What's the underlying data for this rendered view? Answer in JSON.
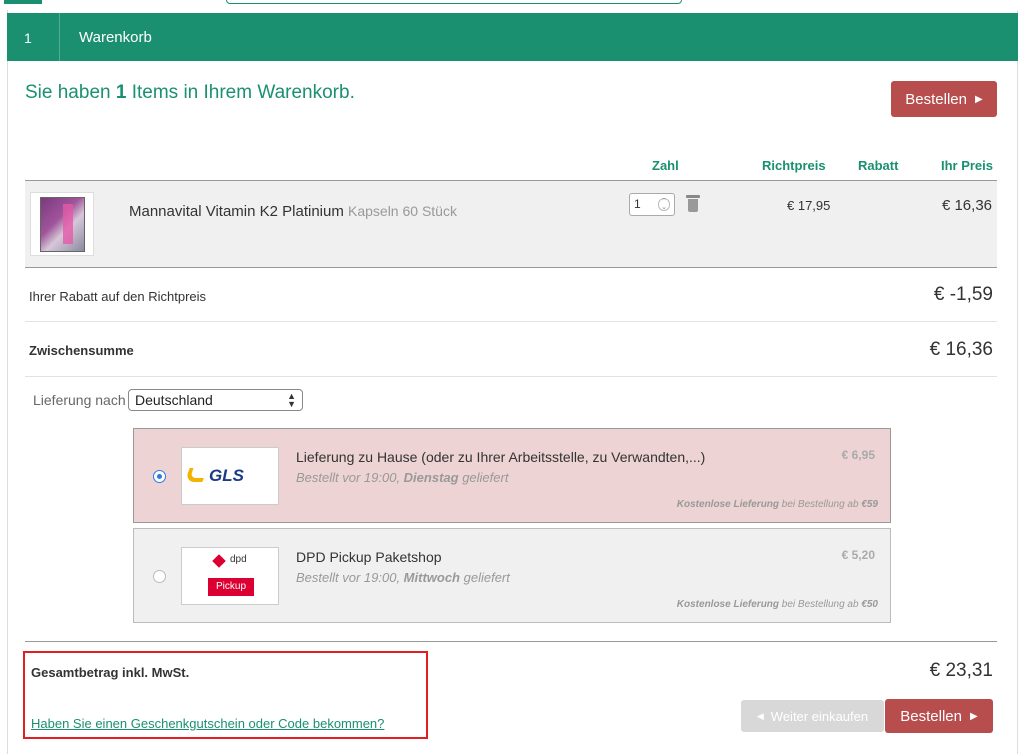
{
  "header": {
    "step": "1",
    "title": "Warenkorb"
  },
  "summary": {
    "prefix": "Sie haben ",
    "count": "1",
    "suffix": " Items in Ihrem Warenkorb."
  },
  "buttons": {
    "order": "Bestellen",
    "continue": "Weiter einkaufen"
  },
  "table": {
    "columns": {
      "qty": "Zahl",
      "list_price": "Richtpreis",
      "discount": "Rabatt",
      "your_price": "Ihr Preis"
    },
    "items": [
      {
        "name": "Mannavital Vitamin K2 Platinium",
        "variant": "Kapseln 60 Stück",
        "qty": "1",
        "list_price": "€ 17,95",
        "discount": "",
        "your_price": "€ 16,36"
      }
    ]
  },
  "totals": {
    "discount_label": "Ihrer Rabatt auf den Richtpreis",
    "discount_value": "€ -1,59",
    "subtotal_label": "Zwischensumme",
    "subtotal_value": "€ 16,36",
    "grand_label": "Gesamtbetrag inkl. MwSt.",
    "grand_value": "€ 23,31"
  },
  "delivery": {
    "label": "Lieferung nach",
    "country": "Deutschland",
    "options": [
      {
        "carrier": "GLS",
        "title": "Lieferung zu Hause (oder zu Ihrer Arbeitsstelle, zu Verwandten,...)",
        "sub_prefix": "Bestellt vor 19:00, ",
        "sub_day": "Dienstag",
        "sub_suffix": " geliefert",
        "price": "€ 6,95",
        "note_bold": "Kostenlose Lieferung",
        "note_mid": " bei Bestellung ab ",
        "note_amount": "€59",
        "selected": true
      },
      {
        "carrier": "dpd",
        "carrier_badge": "Pickup",
        "title": "DPD Pickup Paketshop",
        "sub_prefix": "Bestellt vor 19:00, ",
        "sub_day": "Mittwoch",
        "sub_suffix": " geliefert",
        "price": "€ 5,20",
        "note_bold": "Kostenlose Lieferung",
        "note_mid": " bei Bestellung ab ",
        "note_amount": "€50",
        "selected": false
      }
    ]
  },
  "voucher_link": "Haben Sie einen Geschenkgutschein oder Code bekommen?",
  "colors": {
    "brand_green": "#1a9070",
    "order_red": "#b84d4d",
    "selected_bg": "#edd3d3",
    "highlight_border": "#e02020"
  }
}
